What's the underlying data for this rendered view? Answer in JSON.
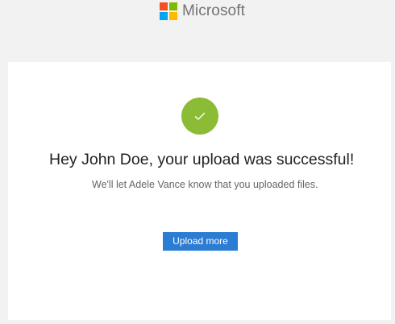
{
  "header": {
    "brand_name": "Microsoft",
    "logo_icon": "microsoft-logo-icon",
    "logo_colors": [
      "#f25022",
      "#7fba00",
      "#00a4ef",
      "#ffb900"
    ],
    "brand_text_color": "#737373"
  },
  "status": {
    "icon": "checkmark-icon",
    "color": "#8cbb35",
    "heading": "Hey John Doe, your upload was successful!",
    "message": "We'll let Adele Vance know that you uploaded files."
  },
  "actions": {
    "upload_more_label": "Upload more",
    "button_color": "#2b7cd3"
  }
}
